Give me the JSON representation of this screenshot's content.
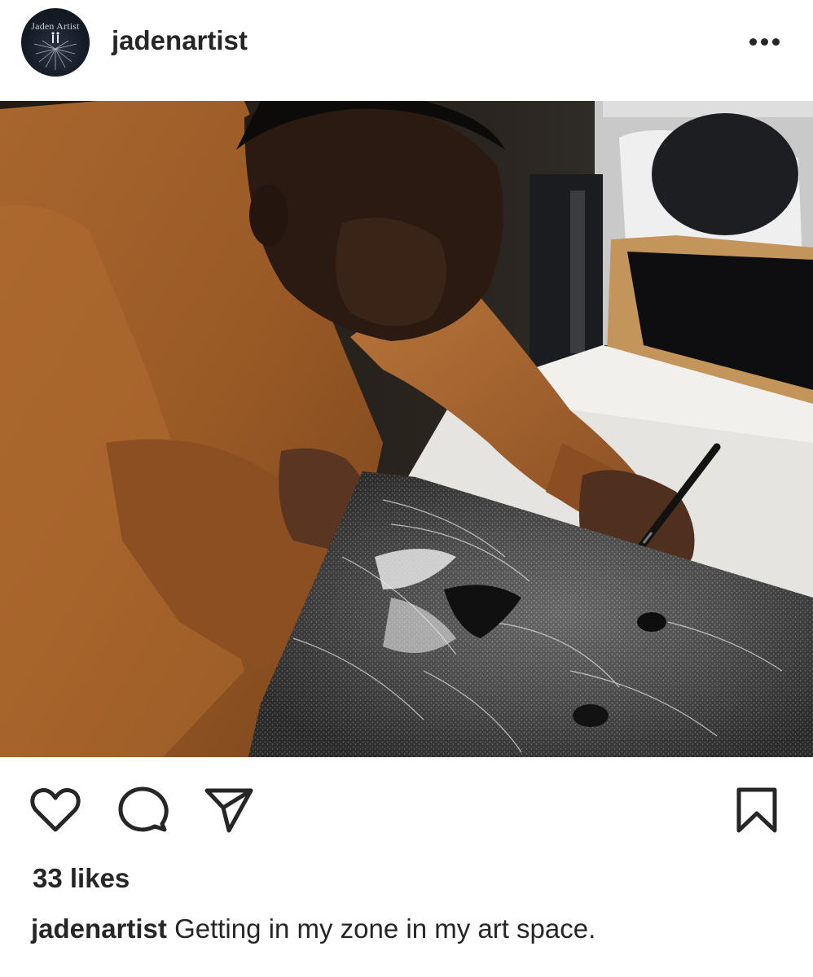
{
  "post": {
    "avatar_label": "Jaden Artist",
    "username": "jadenartist",
    "more_icon": "more-horizontal-icon",
    "photo_alt": "",
    "actions": {
      "like_icon": "heart-icon",
      "comment_icon": "comment-bubble-icon",
      "share_icon": "paper-plane-icon",
      "save_icon": "bookmark-icon"
    },
    "likes_text": "33 likes",
    "caption_user": "jadenartist",
    "caption_text": "Getting in my zone in my art space."
  },
  "colors": {
    "text": "#262626",
    "background": "#ffffff"
  }
}
